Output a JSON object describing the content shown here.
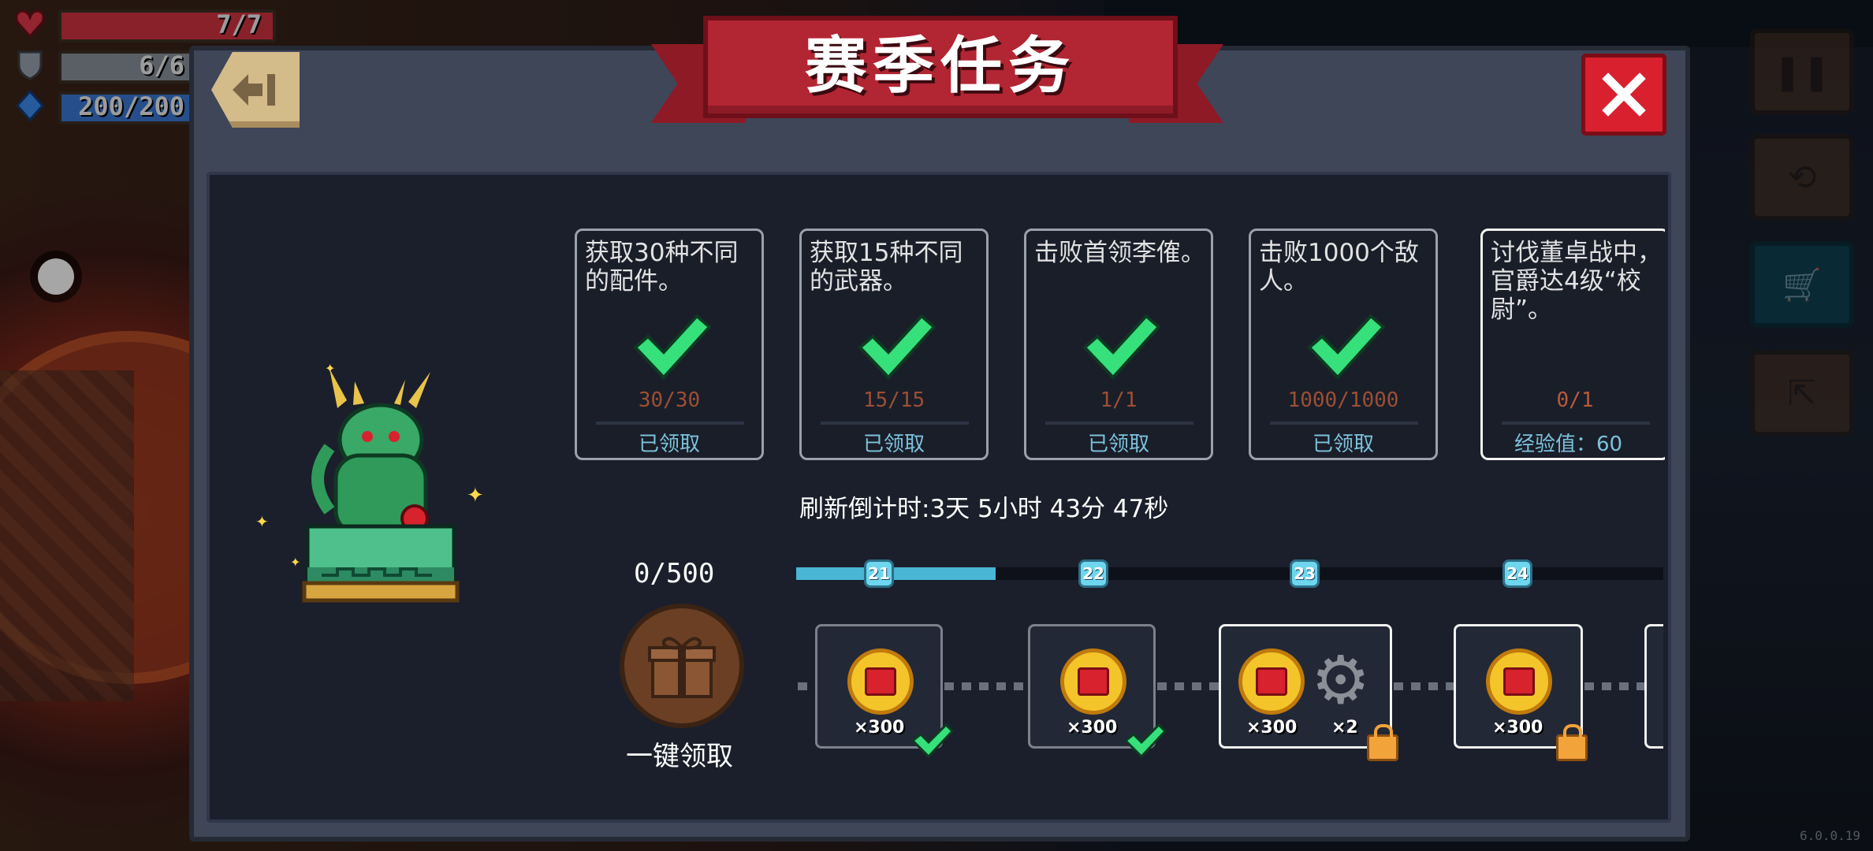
{
  "hud": {
    "health": "7/7",
    "armor": "6/6",
    "energy": "200/200"
  },
  "dialog": {
    "title": "赛季任务"
  },
  "tasks": [
    {
      "desc": "获取30种不同的配件。",
      "progress": "30/30",
      "status": "已领取",
      "completed": true
    },
    {
      "desc": "获取15种不同的武器。",
      "progress": "15/15",
      "status": "已领取",
      "completed": true
    },
    {
      "desc": "击败首领李傕。",
      "progress": "1/1",
      "status": "已领取",
      "completed": true
    },
    {
      "desc": "击败1000个敌人。",
      "progress": "1000/1000",
      "status": "已领取",
      "completed": true
    },
    {
      "desc": "讨伐董卓战中，官爵达4级“校尉”。",
      "progress": "0/1",
      "status": "经验值：60",
      "completed": false
    }
  ],
  "refresh_countdown": "刷新倒计时:3天 5小时 43分 47秒",
  "season": {
    "points": "0/500",
    "claim_all_label": "一键领取",
    "track_progress": 0.23
  },
  "levels": [
    {
      "label": "21",
      "reward_qty": "×300",
      "extra_qty": "",
      "state": "claimed"
    },
    {
      "label": "22",
      "reward_qty": "×300",
      "extra_qty": "",
      "state": "claimed"
    },
    {
      "label": "23",
      "reward_qty": "×300",
      "extra_qty": "×2",
      "state": "locked"
    },
    {
      "label": "24",
      "reward_qty": "×300",
      "extra_qty": "",
      "state": "locked"
    }
  ],
  "version": "6.0.0.19",
  "colors": {
    "accent_red": "#b22533",
    "check_green": "#36e07a",
    "track_blue": "#49b6d6",
    "coin_gold": "#f3c52a"
  },
  "icons": [
    "back-icon",
    "close-icon",
    "check-icon",
    "gift-icon",
    "coin-icon",
    "gear-icon",
    "lock-icon",
    "pause-icon",
    "swap-icon",
    "cart-icon",
    "exit-icon",
    "heart-icon",
    "shield-icon",
    "energy-icon"
  ]
}
